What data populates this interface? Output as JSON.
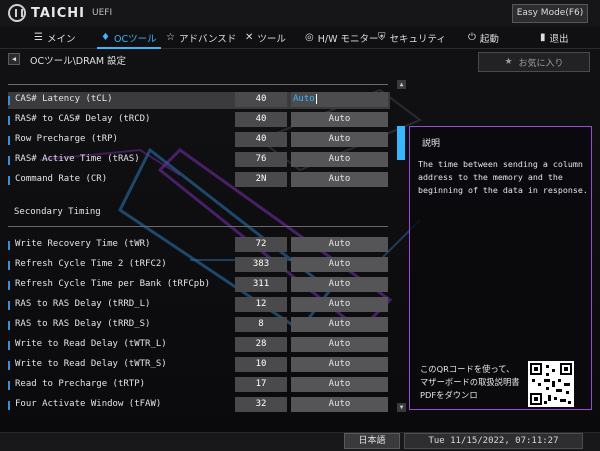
{
  "brand": {
    "name": "TAICHI",
    "sub": "UEFI"
  },
  "mode_button": "Easy Mode(F6)",
  "nav": [
    {
      "label": "メイン",
      "icon": "list-icon"
    },
    {
      "label": "OCツール",
      "icon": "flame-icon"
    },
    {
      "label": "アドバンスド",
      "icon": "star-icon"
    },
    {
      "label": "ツール",
      "icon": "tools-icon"
    },
    {
      "label": "H/W モニター",
      "icon": "monitor-icon"
    },
    {
      "label": "セキュリティ",
      "icon": "shield-icon"
    },
    {
      "label": "起動",
      "icon": "power-icon"
    },
    {
      "label": "退出",
      "icon": "exit-icon"
    }
  ],
  "breadcrumb": "OCツール\\DRAM 設定",
  "favorite_button": "お気に入り",
  "primary_rows": [
    {
      "label": "CAS# Latency (tCL)",
      "value": "40",
      "setting": "Auto",
      "selected": true
    },
    {
      "label": "RAS# to CAS# Delay (tRCD)",
      "value": "40",
      "setting": "Auto"
    },
    {
      "label": "Row Precharge (tRP)",
      "value": "40",
      "setting": "Auto"
    },
    {
      "label": "RAS# Active Time (tRAS)",
      "value": "76",
      "setting": "Auto"
    },
    {
      "label": "Command Rate (CR)",
      "value": "2N",
      "setting": "Auto"
    }
  ],
  "section_title": "Secondary Timing",
  "secondary_rows": [
    {
      "label": "Write Recovery Time (tWR)",
      "value": "72",
      "setting": "Auto"
    },
    {
      "label": "Refresh Cycle Time 2 (tRFC2)",
      "value": "383",
      "setting": "Auto"
    },
    {
      "label": "Refresh Cycle Time per Bank (tRFCpb)",
      "value": "311",
      "setting": "Auto"
    },
    {
      "label": "RAS to RAS Delay (tRRD_L)",
      "value": "12",
      "setting": "Auto"
    },
    {
      "label": "RAS to RAS Delay (tRRD_S)",
      "value": "8",
      "setting": "Auto"
    },
    {
      "label": "Write to Read Delay (tWTR_L)",
      "value": "28",
      "setting": "Auto"
    },
    {
      "label": "Write to Read Delay (tWTR_S)",
      "value": "10",
      "setting": "Auto"
    },
    {
      "label": "Read to Precharge (tRTP)",
      "value": "17",
      "setting": "Auto"
    },
    {
      "label": "Four Activate Window (tFAW)",
      "value": "32",
      "setting": "Auto"
    }
  ],
  "description": {
    "title": "説明",
    "body": "The time between sending a column address to the memory and the beginning of the data in response.",
    "qr_text": "このQRコードを使って、マザーボードの取扱説明書PDFをダウンロ"
  },
  "language": "日本語",
  "datetime": "Tue 11/15/2022, 07:11:27",
  "colors": {
    "accent": "#3ab6ff",
    "panel_border": "#9a4bd8"
  }
}
